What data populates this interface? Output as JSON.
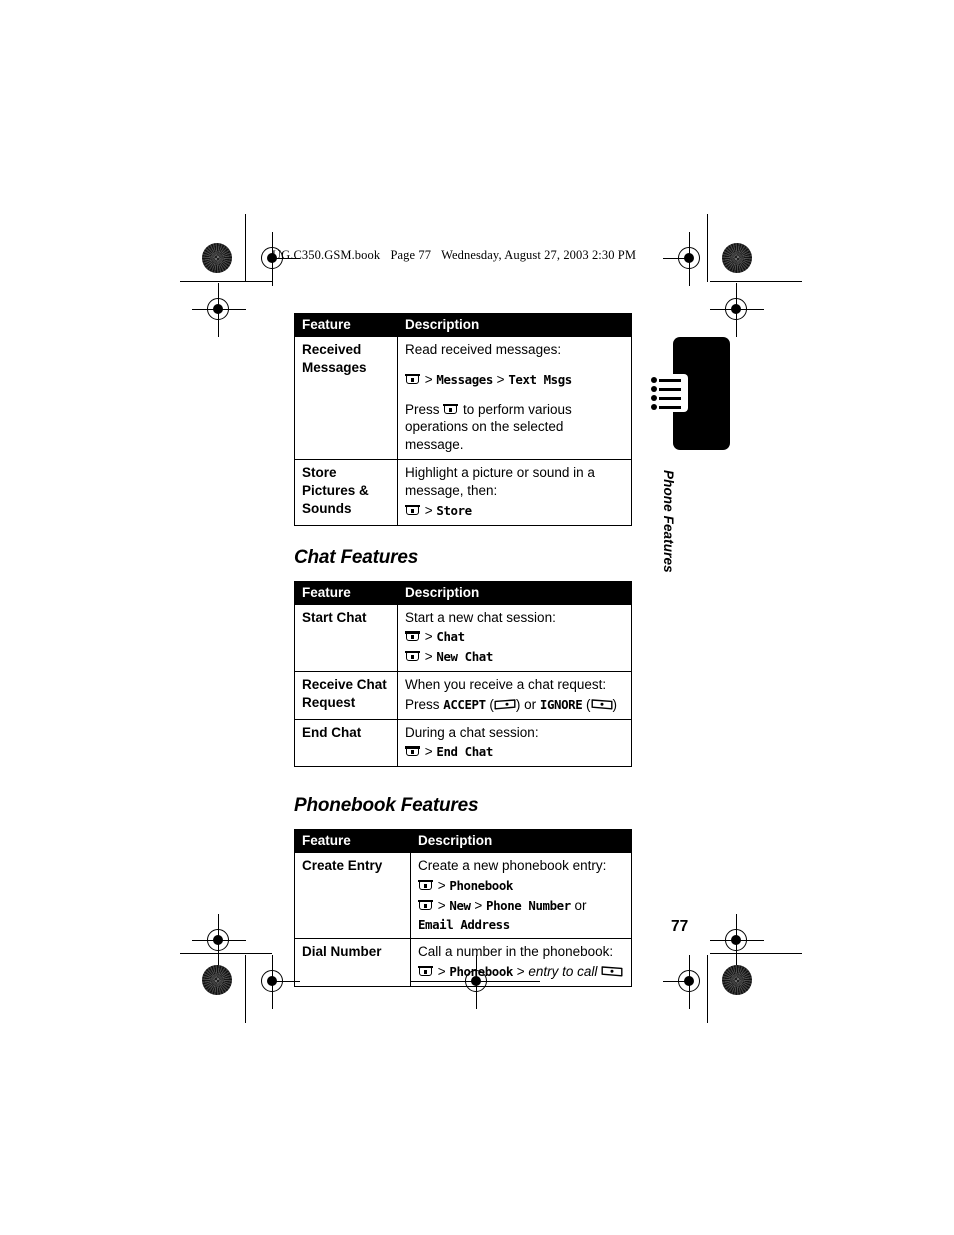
{
  "document": {
    "header": {
      "filename": "UG.C350.GSM.book",
      "page_label": "Page 77",
      "timestamp": "Wednesday, August 27, 2003  2:30 PM"
    },
    "page_number": "77",
    "side_tab": {
      "label": "Phone Features",
      "icon": "bulleted-list-icon"
    }
  },
  "columns": {
    "feature": "Feature",
    "description": "Description"
  },
  "sections": [
    {
      "heading": null,
      "rows": [
        {
          "feature": "Received Messages",
          "lines": [
            {
              "type": "text",
              "value": "Read received messages:"
            },
            {
              "type": "path",
              "menu_key": true,
              "parts": [
                "Messages",
                "Text Msgs"
              ]
            },
            {
              "type": "spacer"
            },
            {
              "type": "mixed",
              "before": "Press ",
              "menu_key": true,
              "after": " to perform various operations on the selected message."
            }
          ]
        },
        {
          "feature": "Store Pictures & Sounds",
          "lines": [
            {
              "type": "text",
              "value": "Highlight a picture or sound in a message, then:"
            },
            {
              "type": "path",
              "menu_key": true,
              "parts": [
                "Store"
              ]
            }
          ]
        }
      ]
    },
    {
      "heading": "Chat Features",
      "rows": [
        {
          "feature": "Start Chat",
          "lines": [
            {
              "type": "text",
              "value": "Start a new chat session:"
            },
            {
              "type": "path",
              "menu_key": true,
              "parts": [
                "Chat"
              ]
            },
            {
              "type": "path",
              "menu_key": true,
              "parts": [
                "New Chat"
              ]
            }
          ]
        },
        {
          "feature": "Receive Chat Request",
          "lines": [
            {
              "type": "text",
              "value": "When you receive a chat request:"
            },
            {
              "type": "softkeys",
              "press": "Press ",
              "accept": "ACCEPT",
              "or": " or ",
              "ignore": "IGNORE"
            }
          ]
        },
        {
          "feature": "End Chat",
          "lines": [
            {
              "type": "text",
              "value": "During a chat session:"
            },
            {
              "type": "path",
              "menu_key": true,
              "parts": [
                "End Chat"
              ]
            }
          ]
        }
      ]
    },
    {
      "heading": "Phonebook Features",
      "rows": [
        {
          "feature": "Create Entry",
          "lines": [
            {
              "type": "text",
              "value": "Create a new phonebook entry:"
            },
            {
              "type": "path",
              "menu_key": true,
              "parts": [
                "Phonebook"
              ]
            },
            {
              "type": "path_or",
              "menu_key": true,
              "parts": [
                "New",
                "Phone Number"
              ],
              "trailing": " or",
              "second_line": "Email Address"
            }
          ]
        },
        {
          "feature": "Dial Number",
          "lines": [
            {
              "type": "text",
              "value": "Call a number in the phonebook:"
            },
            {
              "type": "dial",
              "menu_key": true,
              "first": "Phonebook",
              "italic": "entry to call",
              "softkey": "right-soft-key"
            }
          ]
        }
      ]
    }
  ],
  "colors": {
    "header_bar": "#000000",
    "page_background": "#ffffff",
    "text": "#000000"
  }
}
